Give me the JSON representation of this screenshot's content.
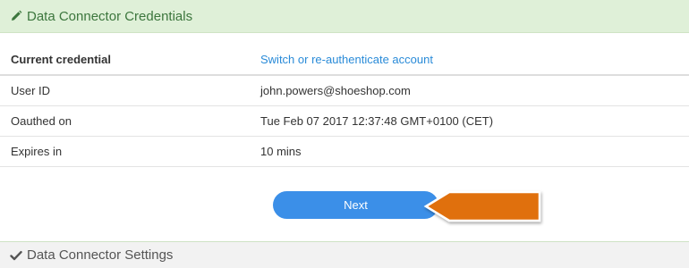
{
  "header": {
    "title": "Data Connector Credentials",
    "icon": "pencil-icon"
  },
  "table": {
    "head_label": "Current credential",
    "head_link": "Switch or re-authenticate account",
    "rows": [
      {
        "label": "User ID",
        "value": "john.powers@shoeshop.com"
      },
      {
        "label": "Oauthed on",
        "value": "Tue Feb 07 2017 12:37:48 GMT+0100 (CET)"
      },
      {
        "label": "Expires in",
        "value": "10 mins"
      }
    ]
  },
  "next_button": {
    "label": "Next"
  },
  "footer": {
    "title": "Data Connector Settings",
    "icon": "check-icon"
  },
  "colors": {
    "header_bg": "#dff0d8",
    "header_text": "#3c763d",
    "link": "#2a8bd8",
    "button": "#3b8fe8",
    "arrow": "#e07010"
  }
}
